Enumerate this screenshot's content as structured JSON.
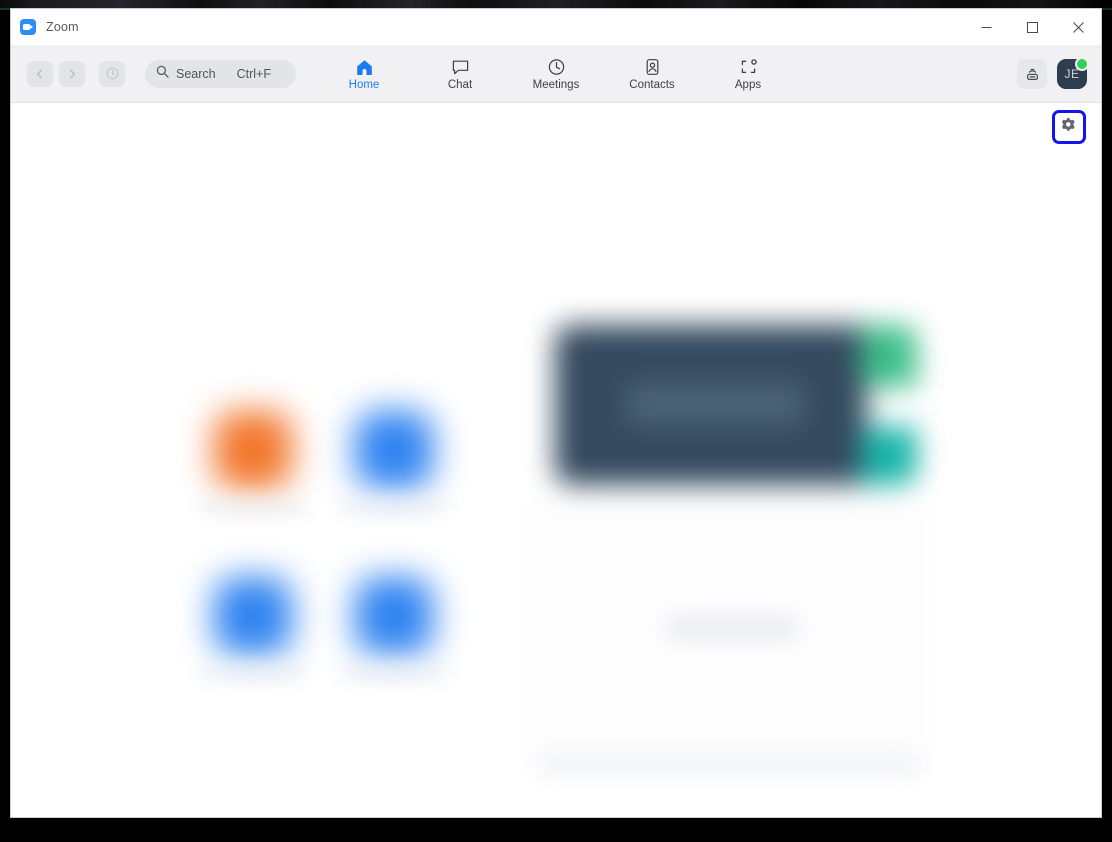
{
  "window": {
    "app_title": "Zoom",
    "app_logo_icon": "zoom-video-logo-icon",
    "controls": {
      "minimize": {
        "icon": "minimize-icon",
        "label": "Minimize"
      },
      "maximize": {
        "icon": "maximize-icon",
        "label": "Maximize"
      },
      "close": {
        "icon": "close-icon",
        "label": "Close"
      }
    }
  },
  "toolbar": {
    "back": {
      "icon": "chevron-left-icon",
      "label": "Back",
      "enabled": false
    },
    "forward": {
      "icon": "chevron-right-icon",
      "label": "Forward",
      "enabled": false
    },
    "history": {
      "icon": "history-clock-icon",
      "label": "History"
    },
    "search": {
      "icon": "search-icon",
      "placeholder": "Search",
      "label": "Search",
      "shortcut": "Ctrl+F"
    },
    "tabs": [
      {
        "label": "Home",
        "icon": "home-icon",
        "active": true
      },
      {
        "label": "Chat",
        "icon": "chat-bubble-icon",
        "active": false
      },
      {
        "label": "Meetings",
        "icon": "clock-icon",
        "active": false
      },
      {
        "label": "Contacts",
        "icon": "contact-card-icon",
        "active": false
      },
      {
        "label": "Apps",
        "icon": "apps-brackets-icon",
        "active": false
      }
    ],
    "cast": {
      "icon": "share-screen-icon",
      "label": "Share screen"
    },
    "profile": {
      "initials": "JE",
      "status": "available",
      "status_color": "#30d158",
      "avatar_color": "#2c3e50"
    }
  },
  "content": {
    "settings": {
      "icon": "gear-icon",
      "label": "Settings",
      "focused": true,
      "focus_ring_color": "#1414f0"
    },
    "home_actions": [
      {
        "label": "New Meeting",
        "icon": "video-camera-icon",
        "color": "#f2762c"
      },
      {
        "label": "Join",
        "icon": "plus-box-icon",
        "color": "#2f83f0"
      },
      {
        "label": "Schedule",
        "icon": "calendar-icon",
        "color": "#2f83f0"
      },
      {
        "label": "Share Screen",
        "icon": "share-screen-arrow-icon",
        "color": "#2f83f0"
      }
    ],
    "clock_card": {
      "body_color": "#34495e",
      "accent_top_color": "#3dbe8b",
      "accent_bottom_color": "#18b4a8"
    },
    "meetings_panel": {
      "empty_message": "No upcoming meetings"
    }
  },
  "colors": {
    "accent_blue": "#2D8CFF",
    "active_tab_blue": "#1a7cf0",
    "toolbar_bg": "#f1f1f4",
    "window_bg": "#ffffff"
  }
}
